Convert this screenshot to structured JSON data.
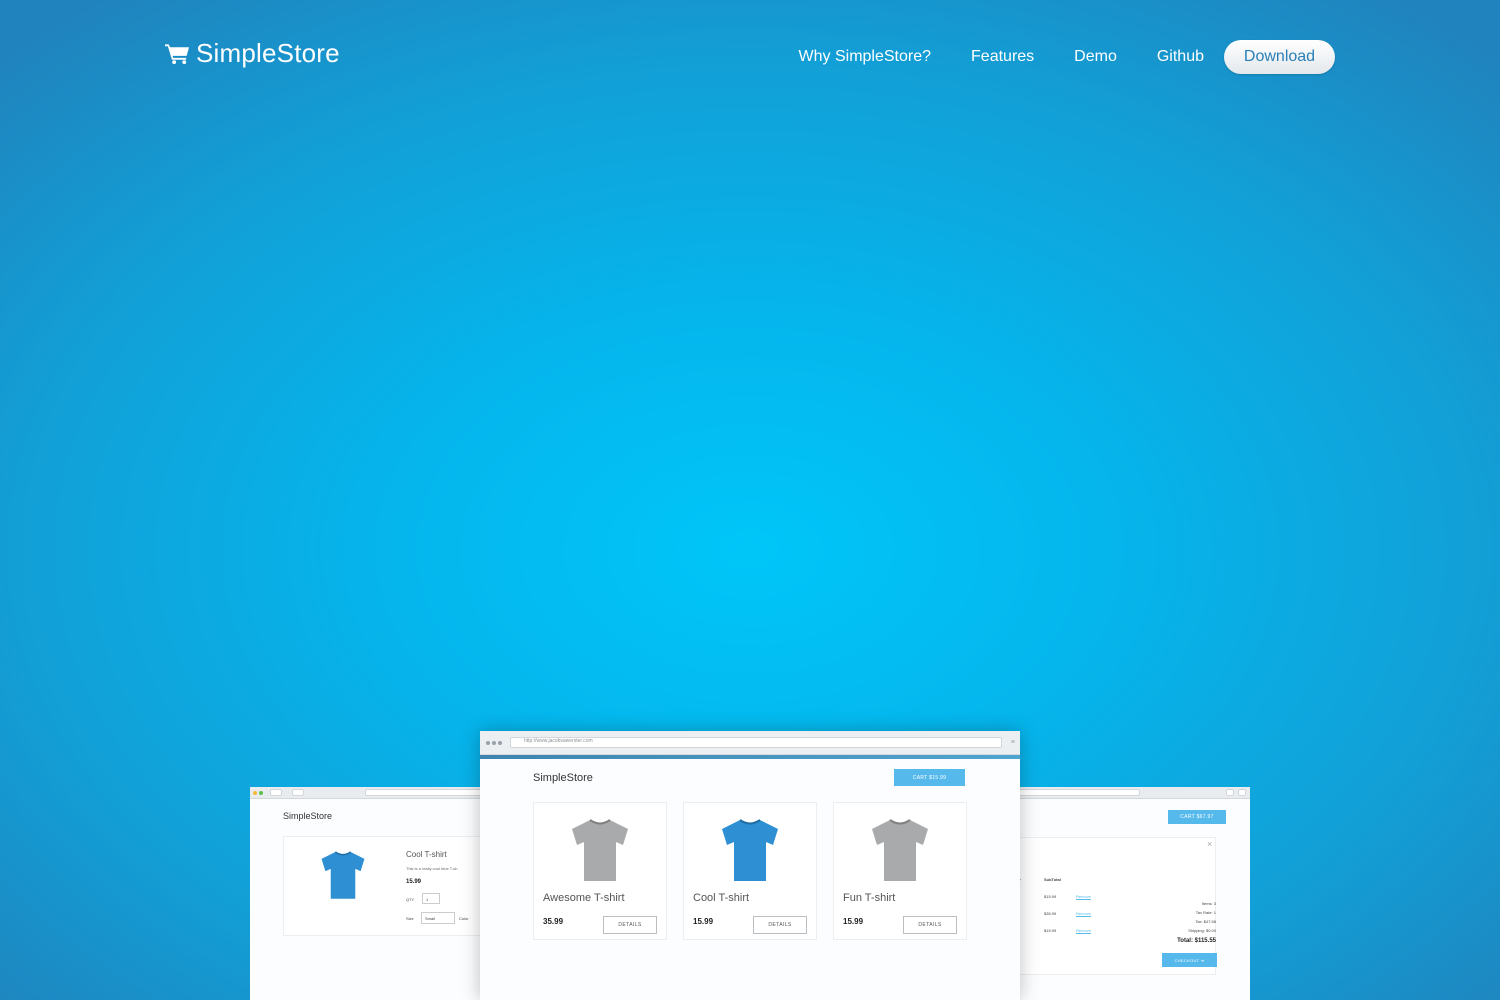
{
  "header": {
    "brand": "SimpleStore",
    "nav": [
      "Why SimpleStore?",
      "Features",
      "Demo",
      "Github"
    ],
    "download": "Download"
  },
  "colors": {
    "accent": "#56b9ec",
    "tshirt_blue": "#2e8fd2",
    "tshirt_gray": "#a9aaab"
  },
  "center_window": {
    "url": "http://www.jacobsawerster.com",
    "store_title": "SimpleStore",
    "cart_button": "CART $15.99",
    "products": [
      {
        "name": "Awesome T-shirt",
        "price": "35.99",
        "button": "DETAILS",
        "color": "gray"
      },
      {
        "name": "Cool T-shirt",
        "price": "15.99",
        "button": "DETAILS",
        "color": "blue"
      },
      {
        "name": "Fun T-shirt",
        "price": "15.99",
        "button": "DETAILS",
        "color": "gray"
      }
    ]
  },
  "left_window": {
    "store_title": "SimpleStore",
    "product_name": "Cool T-shirt",
    "description": "This is a really cool blue T-sh",
    "price": "15.99",
    "qty_label": "QTY",
    "qty_value": "1",
    "size_label": "Size",
    "size_value": "Small",
    "color_label": "Color"
  },
  "right_window": {
    "cart_button": "CART $67.97",
    "close": "×",
    "col_qty": "ty",
    "col_subtotal": "SubTotal",
    "rows": [
      {
        "sub": "$15.99",
        "action": "Remove"
      },
      {
        "sub": "$35.99",
        "action": "Remove"
      },
      {
        "sub": "$15.99",
        "action": "Remove"
      }
    ],
    "items": "Items: 3",
    "tax_rate": "Tax Rate: 1",
    "tax": "Tax: $47.58",
    "shipping": "Shipping: $0.00",
    "total": "Total: $115.55",
    "checkout": "CHECKOUT ➔"
  }
}
